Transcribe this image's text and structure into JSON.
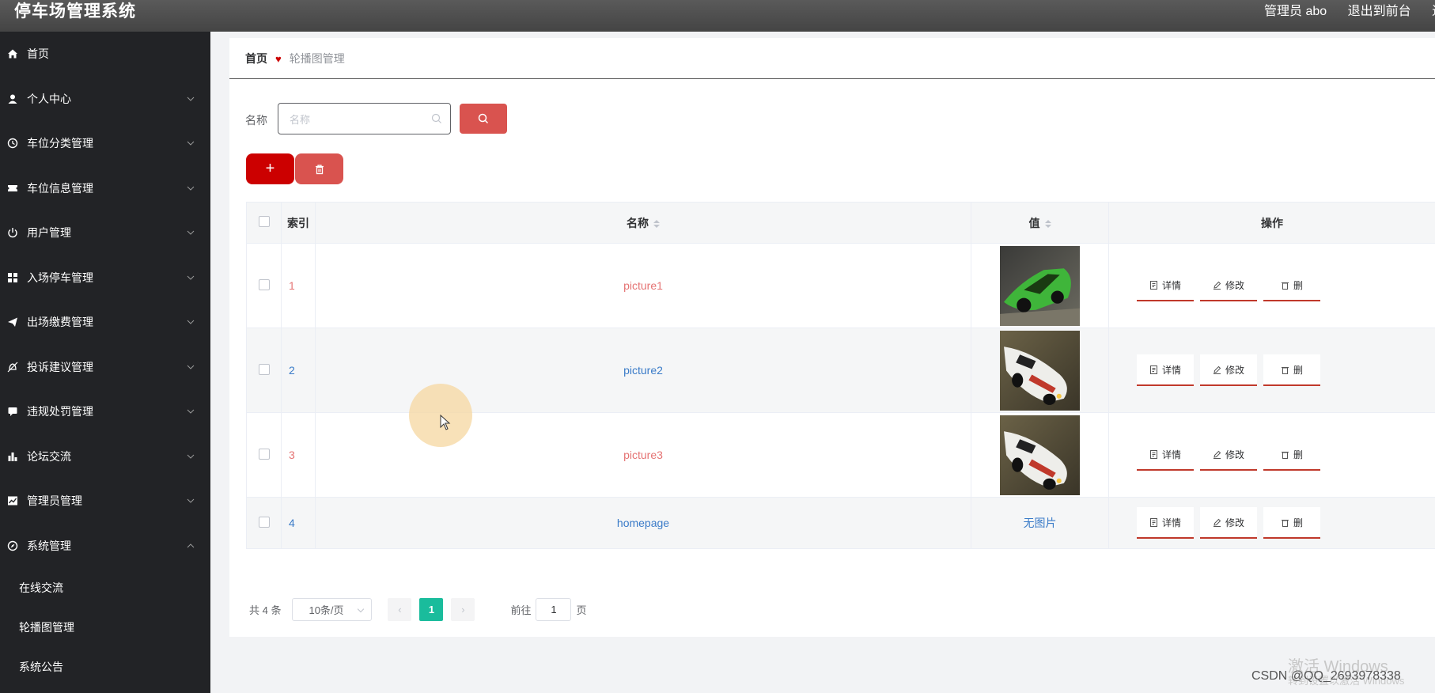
{
  "header": {
    "title": "停车场管理系统",
    "admin": "管理员 abo",
    "back": "退出到前台",
    "extra": "退"
  },
  "sidebar": {
    "items": [
      {
        "label": "首页",
        "icon": "home-icon",
        "expandable": false
      },
      {
        "label": "个人中心",
        "icon": "user-icon",
        "expandable": true
      },
      {
        "label": "车位分类管理",
        "icon": "clock-icon",
        "expandable": true
      },
      {
        "label": "车位信息管理",
        "icon": "ticket-icon",
        "expandable": true
      },
      {
        "label": "用户管理",
        "icon": "power-icon",
        "expandable": true
      },
      {
        "label": "入场停车管理",
        "icon": "grid-icon",
        "expandable": true
      },
      {
        "label": "出场缴费管理",
        "icon": "paper-plane-icon",
        "expandable": true
      },
      {
        "label": "投诉建议管理",
        "icon": "bell-off-icon",
        "expandable": true
      },
      {
        "label": "违规处罚管理",
        "icon": "message-icon",
        "expandable": true
      },
      {
        "label": "论坛交流",
        "icon": "bar-chart-icon",
        "expandable": true
      },
      {
        "label": "管理员管理",
        "icon": "trend-chart-icon",
        "expandable": true
      },
      {
        "label": "系统管理",
        "icon": "compass-icon",
        "expandable": true,
        "expanded": true
      }
    ],
    "subitems": [
      "在线交流",
      "轮播图管理",
      "系统公告"
    ]
  },
  "breadcrumb": {
    "home": "首页",
    "current": "轮播图管理"
  },
  "search": {
    "label": "名称",
    "placeholder": "名称"
  },
  "actions": {
    "add": "+"
  },
  "table": {
    "headers": {
      "index": "索引",
      "name": "名称",
      "value": "值",
      "ops": "操作"
    },
    "rows": [
      {
        "index": "1",
        "name": "picture1",
        "value_type": "image",
        "image": "green-race-car"
      },
      {
        "index": "2",
        "name": "picture2",
        "value_type": "image",
        "image": "white-race-car"
      },
      {
        "index": "3",
        "name": "picture3",
        "value_type": "image",
        "image": "white-race-car"
      },
      {
        "index": "4",
        "name": "homepage",
        "value_type": "text",
        "value": "无图片"
      }
    ],
    "ops": {
      "detail": "详情",
      "edit": "修改",
      "delete": "删"
    }
  },
  "pagination": {
    "total": "共 4 条",
    "page_size": "10条/页",
    "current_page": "1",
    "goto_label": "前往",
    "goto_value": "1",
    "page_unit": "页"
  },
  "overlay": {
    "watermark": "激活 Windows",
    "watermark_sub": "转到设置以激活 Windows",
    "csdn": "CSDN @QQ_2693978338"
  },
  "colors": {
    "header_bg": "#4a4a4a",
    "sidebar_bg": "#222326",
    "primary_red": "#cc0000",
    "search_red": "#d9534f",
    "pager_active": "#1abc9c",
    "link_blue": "#3a7bc8",
    "link_red": "#e57373"
  }
}
